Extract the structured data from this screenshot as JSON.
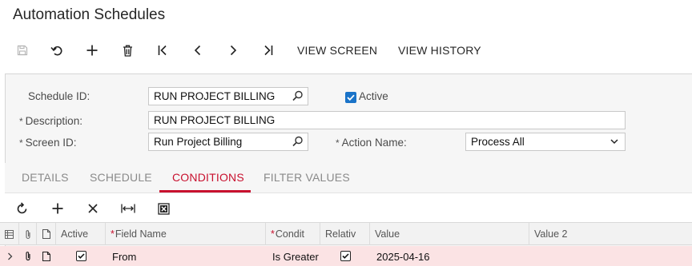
{
  "page": {
    "title": "Automation Schedules"
  },
  "toolbar": {
    "icons": [
      "save-icon",
      "undo-icon",
      "add-icon",
      "delete-icon",
      "first-icon",
      "prev-icon",
      "next-icon",
      "last-icon"
    ],
    "view_screen": "VIEW SCREEN",
    "view_history": "VIEW HISTORY"
  },
  "form": {
    "schedule_id_label": "Schedule ID:",
    "schedule_id_value": "RUN PROJECT BILLING",
    "active_label": "Active",
    "active_checked": true,
    "description_label": "Description:",
    "description_value": "RUN PROJECT BILLING",
    "screen_id_label": "Screen ID:",
    "screen_id_value": "Run Project Billing",
    "action_name_label": "Action Name:",
    "action_name_value": "Process All",
    "required_marker": "*"
  },
  "tabs": [
    {
      "label": "DETAILS",
      "active": false
    },
    {
      "label": "SCHEDULE",
      "active": false
    },
    {
      "label": "CONDITIONS",
      "active": true
    },
    {
      "label": "FILTER VALUES",
      "active": false
    }
  ],
  "grid_toolbar": {
    "icons": [
      "refresh-icon",
      "add-row-icon",
      "delete-row-icon",
      "fit-columns-icon",
      "export-excel-icon"
    ]
  },
  "grid": {
    "columns": [
      "Active",
      "Field Name",
      "Condit",
      "Relativ",
      "Value",
      "Value 2"
    ],
    "required_columns": [
      "Field Name",
      "Condit"
    ],
    "rows": [
      {
        "active": true,
        "field_name": "From",
        "condition": "Is Greater",
        "relative": true,
        "value": "2025-04-16",
        "value2": ""
      }
    ]
  },
  "colors": {
    "accent_red": "#c8102e",
    "checkbox_blue": "#1a73c8",
    "row_highlight": "#fbe3e4"
  }
}
